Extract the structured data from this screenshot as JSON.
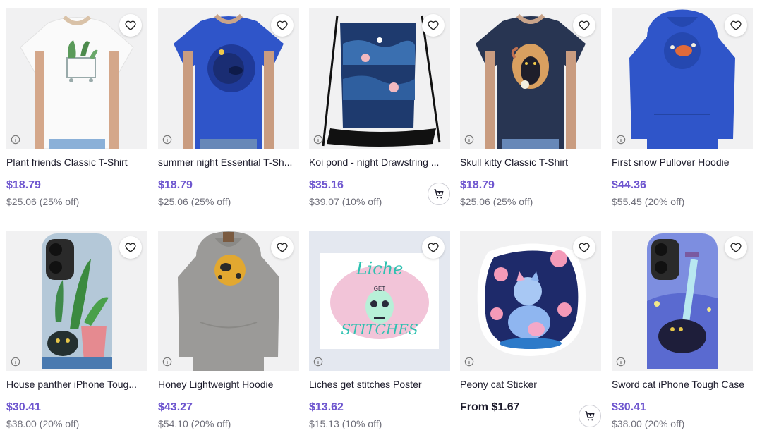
{
  "products": [
    {
      "title": "Plant friends Classic T-Shirt",
      "price": "$18.79",
      "old_price": "$25.06",
      "discount": "(25% off)"
    },
    {
      "title": "summer night Essential T-Sh...",
      "price": "$18.79",
      "old_price": "$25.06",
      "discount": "(25% off)"
    },
    {
      "title": "Koi pond - night Drawstring ...",
      "price": "$35.16",
      "old_price": "$39.07",
      "discount": "(10% off)"
    },
    {
      "title": "Skull kitty Classic T-Shirt",
      "price": "$18.79",
      "old_price": "$25.06",
      "discount": "(25% off)"
    },
    {
      "title": "First snow Pullover Hoodie",
      "price": "$44.36",
      "old_price": "$55.45",
      "discount": "(20% off)"
    },
    {
      "title": "House panther iPhone Toug...",
      "price": "$30.41",
      "old_price": "$38.00",
      "discount": "(20% off)"
    },
    {
      "title": "Honey Lightweight Hoodie",
      "price": "$43.27",
      "old_price": "$54.10",
      "discount": "(20% off)"
    },
    {
      "title": "Liches get stitches Poster",
      "price": "$13.62",
      "old_price": "$15.13",
      "discount": "(10% off)"
    },
    {
      "title": "Peony cat Sticker",
      "price": "From $1.67"
    },
    {
      "title": "Sword cat iPhone Tough Case",
      "price": "$30.41",
      "old_price": "$38.00",
      "discount": "(20% off)"
    }
  ],
  "poster_text": {
    "line1": "Liche",
    "line2": "GET",
    "line3": "STITCHES"
  },
  "colors": {
    "price_accent": "#6e56cf",
    "tile_background": "#f0f0f2",
    "royal_blue": "#2f55c9",
    "navy": "#283552"
  },
  "icons": {
    "favorite": "heart-icon",
    "info": "info-icon",
    "cart": "add-to-cart-icon"
  }
}
